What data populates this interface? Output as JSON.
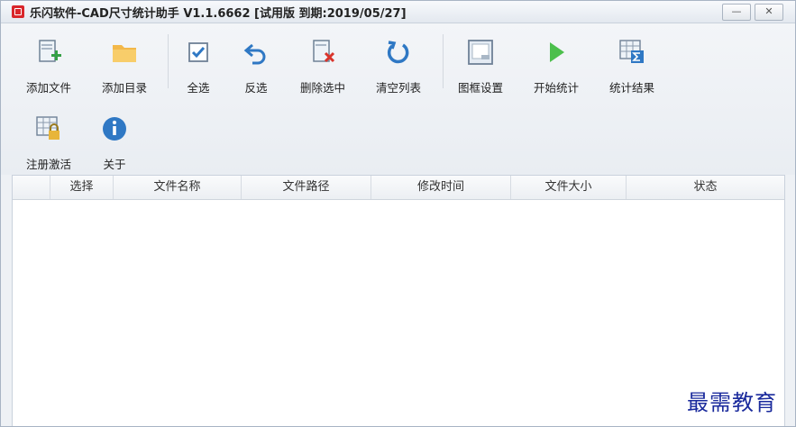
{
  "window": {
    "title": "乐闪软件-CAD尺寸统计助手 V1.1.6662 [试用版 到期:2019/05/27]",
    "minimize_label": "—",
    "close_label": "✕"
  },
  "toolbar": {
    "row1": [
      {
        "label": "添加文件",
        "icon": "add-file-icon"
      },
      {
        "label": "添加目录",
        "icon": "folder-icon"
      },
      {
        "label": "全选",
        "icon": "checkbox-icon"
      },
      {
        "label": "反选",
        "icon": "undo-arrow-icon"
      },
      {
        "label": "删除选中",
        "icon": "delete-selected-icon"
      },
      {
        "label": "清空列表",
        "icon": "refresh-icon"
      },
      {
        "label": "图框设置",
        "icon": "frame-settings-icon"
      },
      {
        "label": "开始统计",
        "icon": "play-icon"
      },
      {
        "label": "统计结果",
        "icon": "sum-table-icon"
      }
    ],
    "row2": [
      {
        "label": "注册激活",
        "icon": "lock-grid-icon"
      },
      {
        "label": "关于",
        "icon": "info-icon"
      }
    ]
  },
  "table": {
    "columns": [
      "",
      "选择",
      "文件名称",
      "文件路径",
      "修改时间",
      "文件大小",
      "状态"
    ],
    "rows": []
  },
  "watermark": "最需教育"
}
